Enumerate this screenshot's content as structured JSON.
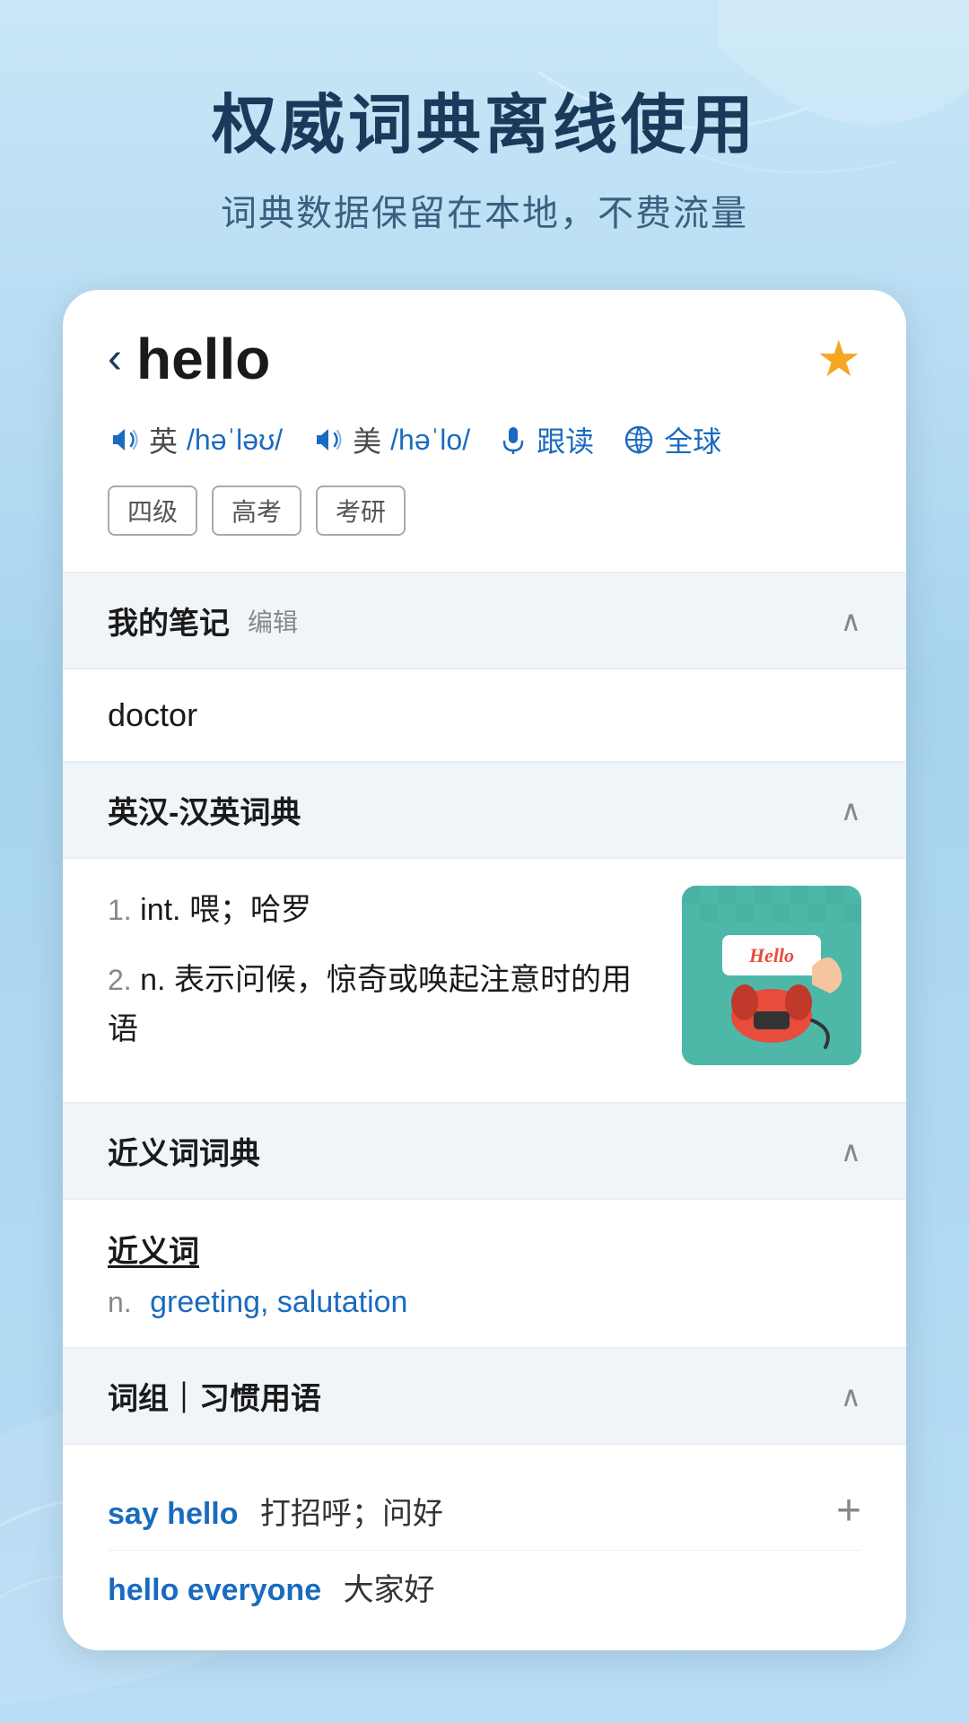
{
  "app": {
    "title": "权威词典离线使用",
    "subtitle": "词典数据保留在本地，不费流量"
  },
  "word": {
    "text": "hello",
    "back_label": "‹",
    "star_label": "★",
    "pronunciation": {
      "uk_label": "英",
      "uk_ipa": "/həˈləʊ/",
      "us_label": "美",
      "us_ipa": "/həˈlo/",
      "follow_read": "跟读",
      "global": "全球"
    },
    "tags": [
      "四级",
      "高考",
      "考研"
    ]
  },
  "sections": {
    "notes": {
      "title": "我的笔记",
      "edit_label": "编辑",
      "content": "doctor"
    },
    "dictionary": {
      "title": "英汉-汉英词典",
      "definitions": [
        {
          "number": "1.",
          "pos": "int.",
          "text": "喂；哈罗"
        },
        {
          "number": "2.",
          "pos": "n.",
          "text": "表示问候，惊奇或唤起注意时的用语"
        }
      ]
    },
    "synonyms": {
      "title": "近义词词典",
      "section_title": "近义词",
      "pos": "n.",
      "words": "greeting, salutation"
    },
    "phrases": {
      "title": "词组｜习惯用语",
      "items": [
        {
          "en": "say hello",
          "cn": "打招呼；问好",
          "has_add": true
        },
        {
          "en": "hello everyone",
          "cn": "大家好",
          "has_add": false
        }
      ]
    }
  },
  "image": {
    "label": "Hello",
    "alt": "hello telephone illustration"
  }
}
